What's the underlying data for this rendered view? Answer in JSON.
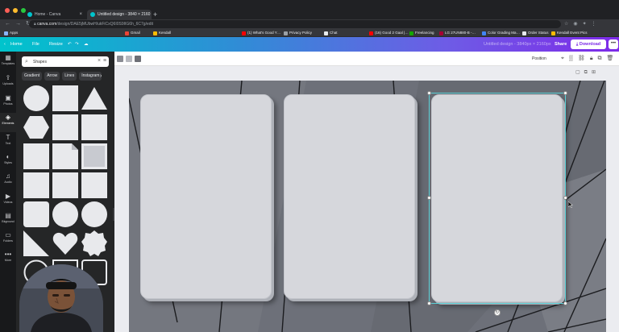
{
  "browser": {
    "tabs": [
      {
        "title": "Home - Canva",
        "active": false
      },
      {
        "title": "Untitled design - 3840 × 2160",
        "active": true
      }
    ],
    "new_tab_symbol": "+",
    "url_host": "canva.com",
    "url_path": "/design/DAE5jMUbwH/ukFiCxQ6I0S9IIG6h_6C7g/edit",
    "bookmarks": [
      "Apps",
      "Gmail",
      "Kendall",
      "(1) What's Good Y…",
      "Privacy Policy",
      "Chat",
      "(16) Good 2 Gaal |…",
      "Freelancing",
      "LG 27UN880-B -…",
      "Color Grading Ma…",
      "Order Status",
      "Kendall Event Pics"
    ]
  },
  "header": {
    "home": "Home",
    "file": "File",
    "resize": "Resize",
    "design_title": "Untitled design - 3840px × 2160px",
    "share": "Share",
    "download": "Download",
    "more": "•••"
  },
  "rail": [
    {
      "label": "Templates",
      "icon": "▦"
    },
    {
      "label": "Uploads",
      "icon": "⇪"
    },
    {
      "label": "Photos",
      "icon": "▣"
    },
    {
      "label": "Elements",
      "icon": "◈",
      "active": true
    },
    {
      "label": "Text",
      "icon": "T"
    },
    {
      "label": "Styles",
      "icon": "◐"
    },
    {
      "label": "Audio",
      "icon": "♫"
    },
    {
      "label": "Videos",
      "icon": "▶"
    },
    {
      "label": "Bkground",
      "icon": "▤"
    },
    {
      "label": "Folders",
      "icon": "▭"
    },
    {
      "label": "More",
      "icon": "•••"
    }
  ],
  "panel": {
    "search_value": "Shapes",
    "chips": [
      "Gradient",
      "Arrow",
      "Lines",
      "Instagram"
    ],
    "chip_next": "›"
  },
  "toolbar": {
    "position": "Position",
    "swatches": [
      "#8a8c93",
      "#b8bac0",
      "#6d6f76"
    ]
  },
  "colors": {
    "accent": "#5bd0d6",
    "brand_start": "#00c4cc",
    "brand_end": "#7d2ae8",
    "card": "#d6d7dc",
    "canvas": "#6d7079"
  }
}
